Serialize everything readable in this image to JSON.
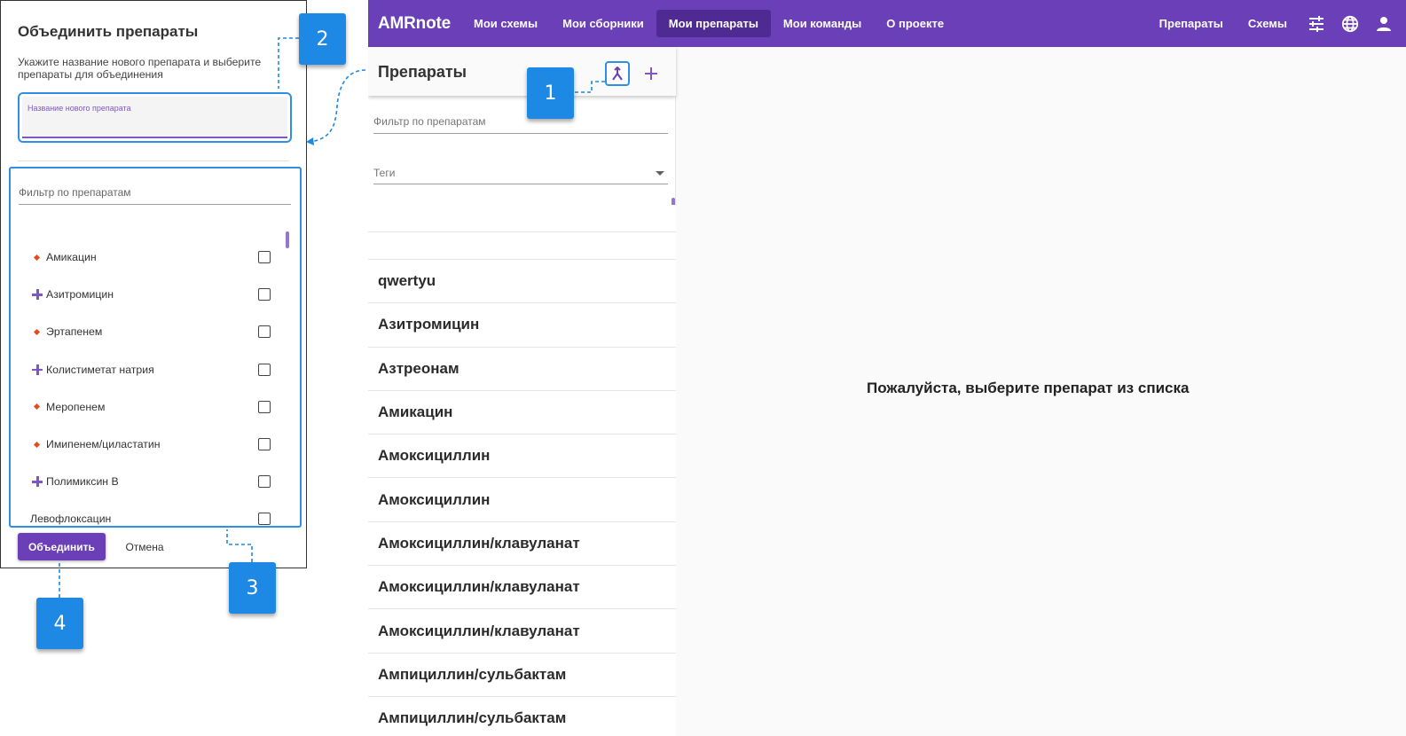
{
  "topbar": {
    "brand": "AMRnote",
    "nav": [
      "Мои схемы",
      "Мои сборники",
      "Мои препараты",
      "Мои команды",
      "О проекте"
    ],
    "right_nav": [
      "Препараты",
      "Схемы"
    ],
    "icons": [
      "tune-icon",
      "globe-icon",
      "account-icon"
    ]
  },
  "sidepanel": {
    "title": "Препараты",
    "filter_placeholder": "Фильтр по препаратам",
    "tags_placeholder": "Теги",
    "drugs": [
      "qwertyu",
      "Азитромицин",
      "Азтреонам",
      "Амикацин",
      "Амоксициллин",
      "Амоксициллин",
      "Амоксициллин/клавуланат",
      "Амоксициллин/клавуланат",
      "Амоксициллин/клавуланат",
      "Ампициллин/сульбактам",
      "Ампициллин/сульбактам"
    ]
  },
  "main": {
    "placeholder": "Пожалуйста, выберите препарат из списка"
  },
  "dialog": {
    "title": "Объединить препараты",
    "description": "Укажите название нового препарата и выберите препараты для объединения",
    "name_label": "Название нового препарата",
    "filter_placeholder": "Фильтр по препаратам",
    "options": [
      {
        "label": "Амикацин",
        "marker": "diamond"
      },
      {
        "label": "Азитромицин",
        "marker": "plus"
      },
      {
        "label": "Эртапенем",
        "marker": "diamond"
      },
      {
        "label": "Колистиметат натрия",
        "marker": "plus"
      },
      {
        "label": "Меропенем",
        "marker": "diamond"
      },
      {
        "label": "Имипенем/циластатин",
        "marker": "diamond"
      },
      {
        "label": "Полимиксин В",
        "marker": "plus"
      },
      {
        "label": "Левофлоксацин",
        "marker": "none"
      }
    ],
    "merge_label": "Объединить",
    "cancel_label": "Отмена"
  },
  "callouts": [
    "1",
    "2",
    "3",
    "4"
  ],
  "colors": {
    "primary": "#6a3fb7",
    "primary_dark": "#4f2a92",
    "accent": "#7e57c2",
    "annotation": "#1e88e5",
    "diamond": "#e64a19"
  }
}
